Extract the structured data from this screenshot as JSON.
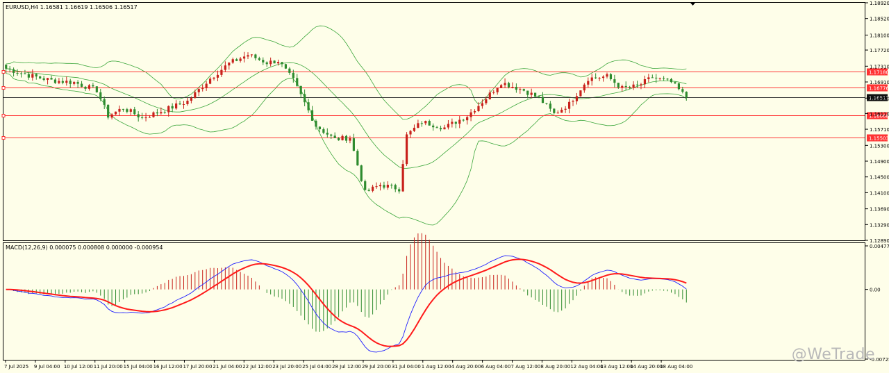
{
  "main": {
    "symbol_info": "EURUSD,H4  1.16581 1.16619 1.16506 1.16517",
    "y_ticks": [
      "1.18920",
      "1.18520",
      "1.18100",
      "1.17720",
      "1.17310",
      "1.16910",
      "1.16500",
      "1.16110",
      "1.15710",
      "1.15300",
      "1.14900",
      "1.14500",
      "1.14100",
      "1.13690",
      "1.13290",
      "1.12890"
    ],
    "hlines": [
      {
        "price": 1.1718,
        "label": "1.17180",
        "color": "#ff3333"
      },
      {
        "price": 1.16776,
        "label": "1.16776",
        "color": "#ff3333"
      },
      {
        "price": 1.16068,
        "label": "1.16068",
        "color": "#ff3333"
      },
      {
        "price": 1.15503,
        "label": "1.15503",
        "color": "#ff3333"
      }
    ],
    "current_price": {
      "price": 1.16517,
      "label": "1.16517"
    }
  },
  "macd": {
    "label": "MACD(12,26,9) 0.000075 0.000808 0.000000 -0.000954",
    "y_ticks": [
      "0.004774",
      "0.00",
      "-0.007257"
    ]
  },
  "x_labels": [
    "7 Jul 2025",
    "9 Jul 04:00",
    "10 Jul 12:00",
    "11 Jul 20:00",
    "15 Jul 04:00",
    "16 Jul 12:00",
    "17 Jul 20:00",
    "21 Jul 04:00",
    "22 Jul 12:00",
    "23 Jul 20:00",
    "25 Jul 04:00",
    "28 Jul 12:00",
    "29 Jul 20:00",
    "31 Jul 04:00",
    "1 Aug 12:00",
    "4 Aug 20:00",
    "6 Aug 04:00",
    "7 Aug 12:00",
    "8 Aug 20:00",
    "12 Aug 04:00",
    "13 Aug 12:00",
    "14 Aug 20:00",
    "18 Aug 04:00"
  ],
  "watermark": "@WeTrade",
  "colors": {
    "bull": "#c8211b",
    "bear": "#2e8b2e",
    "band": "#3aa63a",
    "macd_main": "#1f1fff",
    "macd_signal": "#ff1a1a",
    "bg": "#fefee9"
  },
  "chart_data": {
    "type": "candlestick",
    "instrument": "EURUSD",
    "timeframe": "H4",
    "ylim": [
      1.1289,
      1.1892
    ],
    "price_path": [
      [
        0,
        1.1725
      ],
      [
        6,
        1.1708
      ],
      [
        12,
        1.1695
      ],
      [
        18,
        1.169
      ],
      [
        24,
        1.167
      ],
      [
        27,
        1.1605
      ],
      [
        31,
        1.1625
      ],
      [
        36,
        1.16
      ],
      [
        42,
        1.162
      ],
      [
        48,
        1.1642
      ],
      [
        54,
        1.17
      ],
      [
        59,
        1.1738
      ],
      [
        64,
        1.176
      ],
      [
        69,
        1.174
      ],
      [
        72,
        1.1745
      ],
      [
        76,
        1.1695
      ],
      [
        82,
        1.158
      ],
      [
        87,
        1.1545
      ],
      [
        91,
        1.155
      ],
      [
        95,
        1.141
      ],
      [
        99,
        1.143
      ],
      [
        104,
        1.142
      ],
      [
        106,
        1.1555
      ],
      [
        110,
        1.159
      ],
      [
        116,
        1.1575
      ],
      [
        122,
        1.1605
      ],
      [
        127,
        1.165
      ],
      [
        131,
        1.169
      ],
      [
        137,
        1.167
      ],
      [
        141,
        1.165
      ],
      [
        145,
        1.161
      ],
      [
        149,
        1.1635
      ],
      [
        154,
        1.17
      ],
      [
        159,
        1.1705
      ],
      [
        163,
        1.1675
      ],
      [
        167,
        1.168
      ],
      [
        171,
        1.1703
      ],
      [
        176,
        1.169
      ],
      [
        180,
        1.1652
      ]
    ],
    "macd_ylim": [
      -0.007257,
      0.004774
    ]
  }
}
